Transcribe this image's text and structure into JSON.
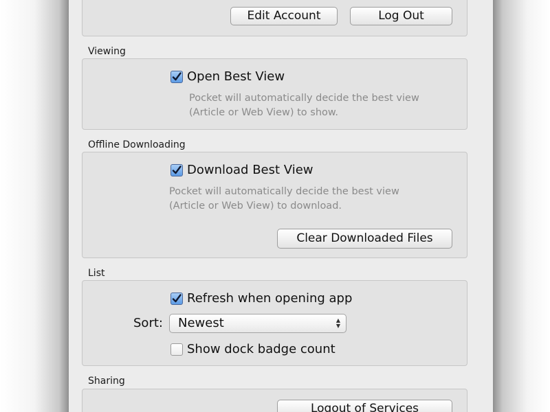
{
  "account": {
    "edit_button": "Edit Account",
    "logout_button": "Log Out"
  },
  "viewing": {
    "section_label": "Viewing",
    "checkbox_label": "Open Best View",
    "checked": true,
    "description_line1": "Pocket will automatically decide the best view",
    "description_line2": "(Article or Web View) to show."
  },
  "offline": {
    "section_label": "Offline Downloading",
    "checkbox_label": "Download Best View",
    "checked": true,
    "description_line1": "Pocket will automatically decide the best view",
    "description_line2": "(Article or Web View) to download.",
    "clear_button": "Clear Downloaded Files"
  },
  "list": {
    "section_label": "List",
    "refresh_label": "Refresh when opening app",
    "refresh_checked": true,
    "sort_label": "Sort:",
    "sort_value": "Newest",
    "badge_label": "Show dock badge count",
    "badge_checked": false
  },
  "sharing": {
    "section_label": "Sharing",
    "logout_services_button": "Logout of Services"
  },
  "colors": {
    "window_bg": "#ececec",
    "group_bg": "#e3e3e3",
    "checkbox_checked": "#5d9be6",
    "description_text": "#8a8a8a"
  }
}
